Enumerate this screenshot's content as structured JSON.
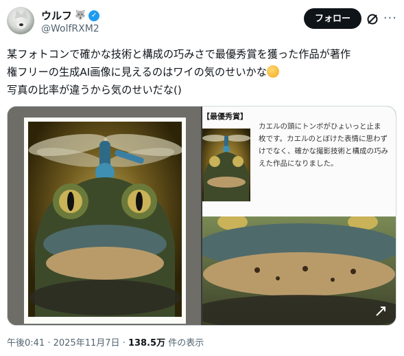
{
  "author": {
    "display_name": "ウルフ",
    "name_emoji": "🐺",
    "handle": "@WolfRXM2",
    "verified_icon": "verified-badge-icon",
    "avatar_icon": "wolf-avatar"
  },
  "actions": {
    "follow_label": "フォロー",
    "grok_icon": "grok-icon",
    "more_icon": "more-icon"
  },
  "post": {
    "line1": "某フォトコンで確かな技術と構成の巧みさで最優秀賞を獲った作品が著作",
    "line2": "権フリーの生成AI画像に見えるのはワイの気のせいかな",
    "line2_emoji": "thinking-face-emoji",
    "line3": "写真の比率が違うから気のせいだな()"
  },
  "media": {
    "right_award_label": "【最優秀賞】",
    "right_description": "カエルの頭にトンボがひょいっと止ま\n枚です。カエルのとぼけた表情に思わず\nけでなく、確かな撮影技術と構成の巧み\nえた作品になりました。",
    "expand_icon": "expand-icon"
  },
  "meta": {
    "time": "午後0:41",
    "separator": "·",
    "date": "2025年11月7日",
    "views_count": "138.5万",
    "views_label": "件の表示"
  },
  "colors": {
    "accent": "#1d9bf0",
    "text_primary": "#0f1419",
    "text_secondary": "#536471",
    "button_bg": "#0f1419"
  }
}
